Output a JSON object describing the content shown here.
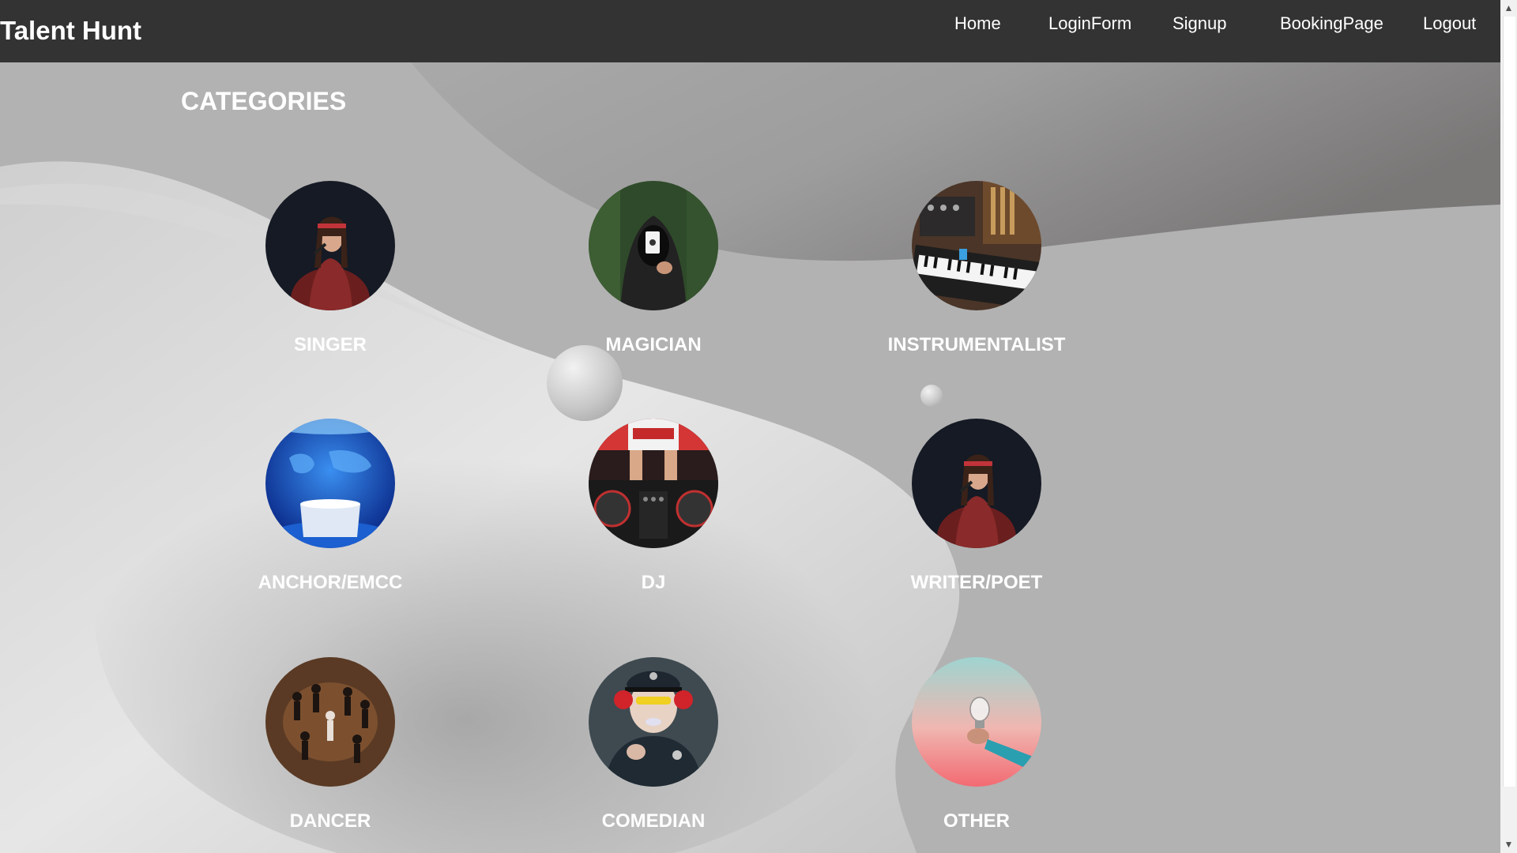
{
  "app": {
    "brand": "Talent Hunt"
  },
  "nav": {
    "links": [
      "Home",
      "LoginForm",
      "Signup",
      "BookingPage",
      "Logout"
    ]
  },
  "main": {
    "heading": "CATEGORIES",
    "categories": [
      {
        "label": "SINGER",
        "icon": "singer-photo"
      },
      {
        "label": "MAGICIAN",
        "icon": "magician-photo"
      },
      {
        "label": "INSTRUMENTALIST",
        "icon": "instrumentalist-photo"
      },
      {
        "label": "ANCHOR/EMCC",
        "icon": "anchor-photo"
      },
      {
        "label": "DJ",
        "icon": "dj-photo"
      },
      {
        "label": "WRITER/POET",
        "icon": "writer-poet-photo"
      },
      {
        "label": "DANCER",
        "icon": "dancer-photo"
      },
      {
        "label": "COMEDIAN",
        "icon": "comedian-photo"
      },
      {
        "label": "OTHER",
        "icon": "other-photo"
      }
    ]
  },
  "colors": {
    "navbar": "#333333",
    "text": "#ffffff",
    "background": "#aaaaaa"
  }
}
